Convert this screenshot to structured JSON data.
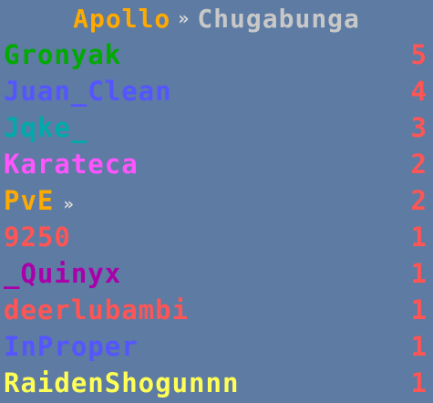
{
  "header": {
    "server": "Apollo",
    "separator": "»",
    "region": "Chugabunga",
    "server_color": "#ffaa00",
    "separator_color": "#d8d8d8",
    "region_color": "#c8c8c8"
  },
  "score_color": "#ff5555",
  "players": [
    {
      "name": "Gronyak",
      "color": "#00aa00",
      "score": "5",
      "arrow": ""
    },
    {
      "name": "Juan_Clean",
      "color": "#5555ff",
      "score": "4",
      "arrow": ""
    },
    {
      "name": "Jqke_",
      "color": "#00aaaa",
      "score": "3",
      "arrow": ""
    },
    {
      "name": "Karateca",
      "color": "#ff55ff",
      "score": "2",
      "arrow": ""
    },
    {
      "name": "PvE",
      "color": "#ffaa00",
      "score": "2",
      "arrow": "»"
    },
    {
      "name": "9250",
      "color": "#ff5555",
      "score": "1",
      "arrow": ""
    },
    {
      "name": "_Quinyx",
      "color": "#aa00aa",
      "score": "1",
      "arrow": ""
    },
    {
      "name": "deerlubambi",
      "color": "#ff5555",
      "score": "1",
      "arrow": ""
    },
    {
      "name": "InProper",
      "color": "#5555ff",
      "score": "1",
      "arrow": ""
    },
    {
      "name": "RaidenShogunnn",
      "color": "#ffff55",
      "score": "1",
      "arrow": ""
    }
  ]
}
